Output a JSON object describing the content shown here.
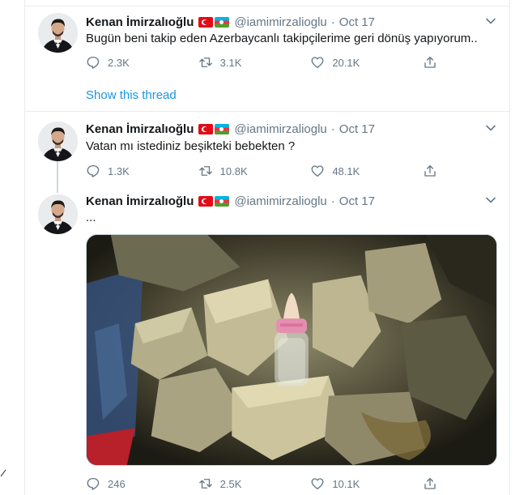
{
  "tweets": [
    {
      "name": "Kenan İmirzalıoğlu",
      "handle": "@iamimirzalioglu",
      "date": "Oct 17",
      "text": "Bugün beni takip eden Azerbaycanlı takipçilerime geri dönüş yapıyorum..",
      "replies": "2.3K",
      "retweets": "3.1K",
      "likes": "20.1K",
      "thread_link": "Show this thread"
    },
    {
      "name": "Kenan İmirzalıoğlu",
      "handle": "@iamimirzalioglu",
      "date": "Oct 17",
      "text": "Vatan mı istediniz beşikteki bebekten ?",
      "replies": "1.3K",
      "retweets": "10.8K",
      "likes": "48.1K"
    },
    {
      "name": "Kenan İmirzalıoğlu",
      "handle": "@iamimirzalioglu",
      "date": "Oct 17",
      "text": "...",
      "replies": "246",
      "retweets": "2.5K",
      "likes": "10.1K",
      "media": "photo of a baby bottle among rubble"
    }
  ],
  "colors": {
    "text": "#14171a",
    "secondary": "#657786",
    "link": "#1b95e0",
    "border": "#e6ecf0"
  },
  "icons": [
    "reply-icon",
    "retweet-icon",
    "like-icon",
    "share-icon",
    "chevron-down-icon"
  ]
}
